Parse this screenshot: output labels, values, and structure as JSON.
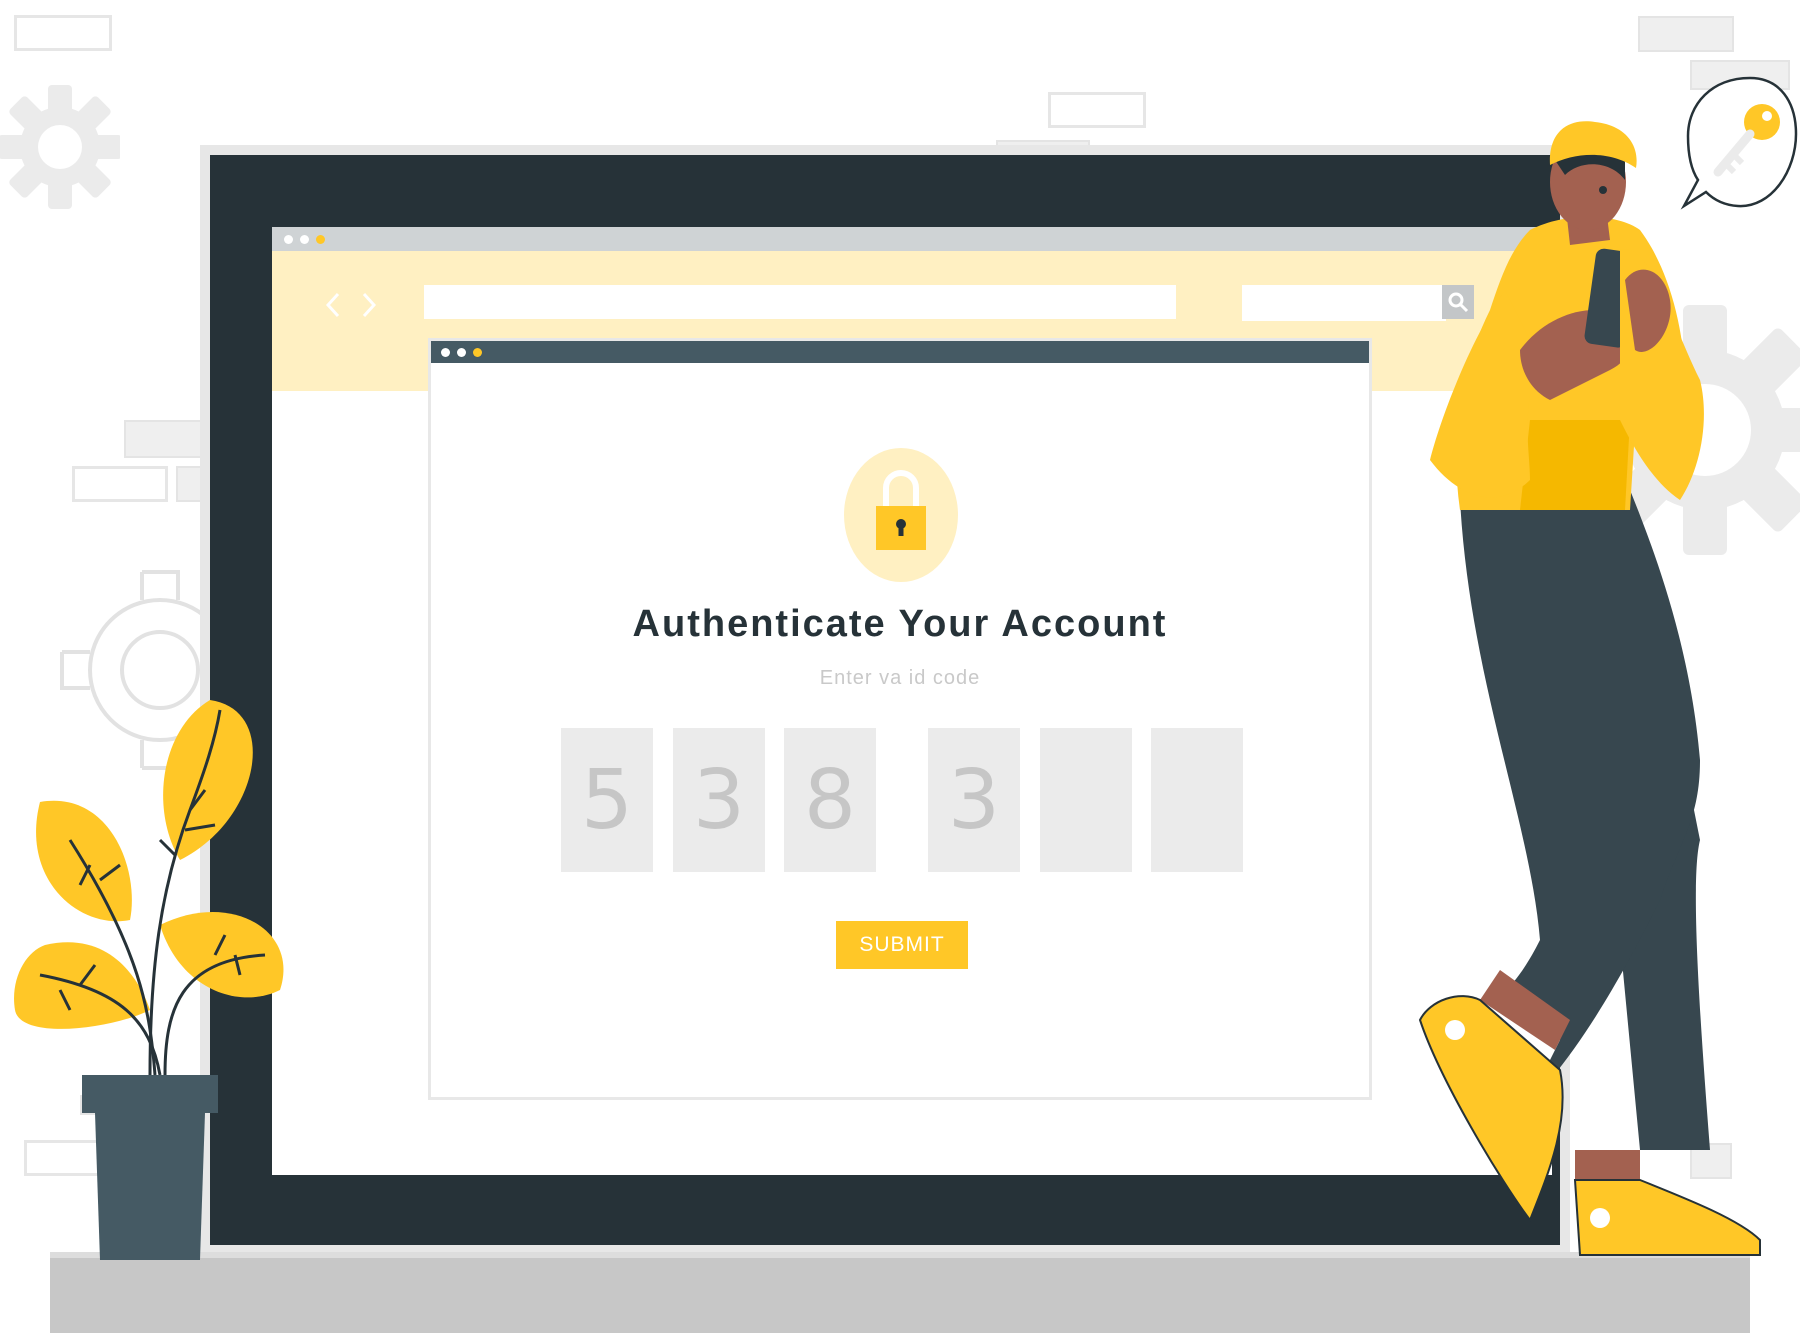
{
  "colors": {
    "accent": "#ffc727",
    "accent_light": "#fff0c2",
    "dark": "#263238",
    "slate": "#455a64",
    "gray_box": "#ebebeb"
  },
  "browser": {
    "back_icon": "chevron-left-icon",
    "forward_icon": "chevron-right-icon",
    "url_value": "",
    "search_value": "",
    "search_icon": "search-icon"
  },
  "auth": {
    "lock_icon": "padlock-icon",
    "title": "Authenticate Your Account",
    "subtitle": "Enter va id code",
    "digits": [
      "5",
      "3",
      "8",
      "3",
      "",
      ""
    ],
    "submit_label": "SUBMIT"
  },
  "person": {
    "speech_bubble_icon": "key-icon",
    "phone_icon": "smartphone-icon"
  }
}
